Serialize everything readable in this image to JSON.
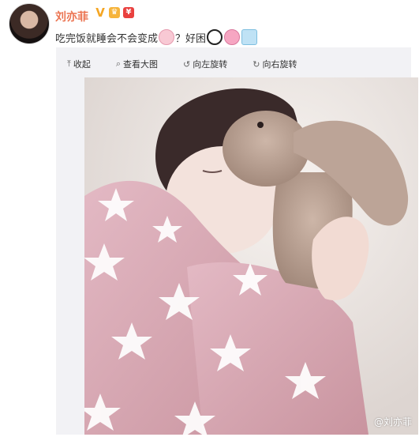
{
  "user": {
    "name": "刘亦菲",
    "verified_badge": "V"
  },
  "post": {
    "text_part1": "吃完饭就睡会不会变成",
    "text_part2": "？好困"
  },
  "toolbar": {
    "collapse_label": "收起",
    "collapse_icon": "arrow-up",
    "view_large_label": "查看大图",
    "view_large_icon": "search",
    "rotate_left_label": "向左旋转",
    "rotate_left_icon": "rotate-left",
    "rotate_right_label": "向右旋转",
    "rotate_right_icon": "rotate-right"
  },
  "photo": {
    "watermark": "@刘亦菲"
  },
  "colors": {
    "username": "#eb7350",
    "panel_bg": "#f2f2f5",
    "blanket_pink": "#d8a9b6",
    "bunny": "#b9a193"
  }
}
